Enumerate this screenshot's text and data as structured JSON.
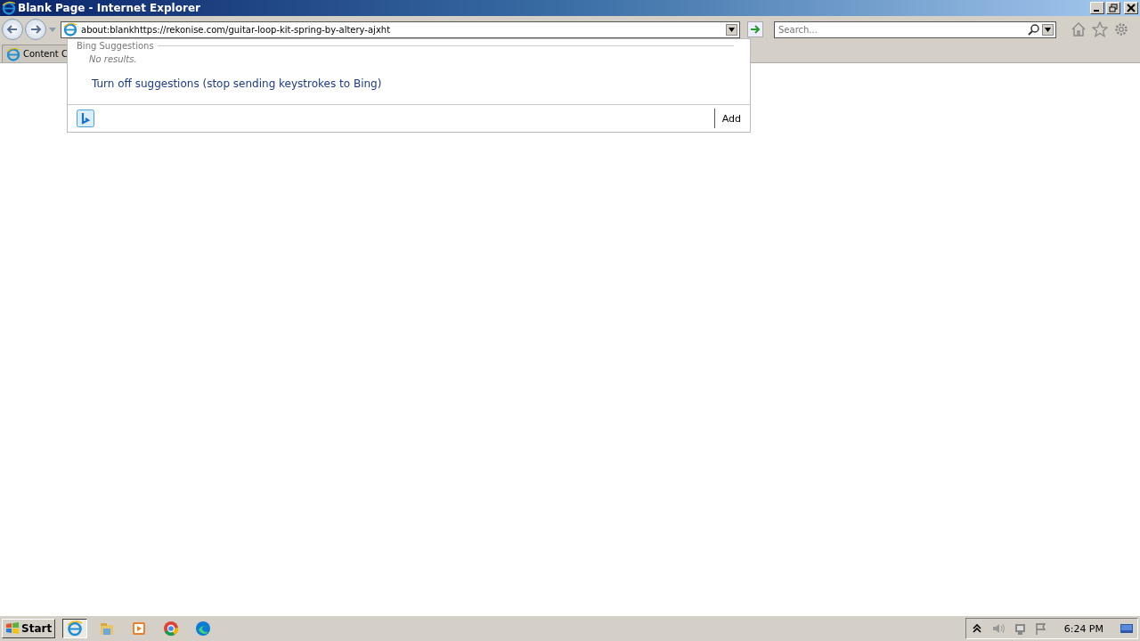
{
  "window": {
    "title": "Blank Page - Internet Explorer"
  },
  "address_bar": {
    "value": "about:blankhttps://rekonise.com/guitar-loop-kit-spring-by-altery-ajxht"
  },
  "search": {
    "placeholder": "Search..."
  },
  "tabs": [
    {
      "label": "Content C",
      "selected": false
    }
  ],
  "suggestions": {
    "heading": "Bing Suggestions",
    "empty_text": "No results.",
    "turn_off_link": "Turn off suggestions (stop sending keystrokes to Bing)",
    "add_button": "Add"
  },
  "taskbar": {
    "start": "Start",
    "apps": [
      {
        "kind": "ie",
        "selected": true
      },
      {
        "kind": "explorer",
        "selected": false
      },
      {
        "kind": "media",
        "selected": false
      },
      {
        "kind": "chrome",
        "selected": false
      },
      {
        "kind": "edge",
        "selected": false
      }
    ],
    "clock": "6:24 PM"
  }
}
